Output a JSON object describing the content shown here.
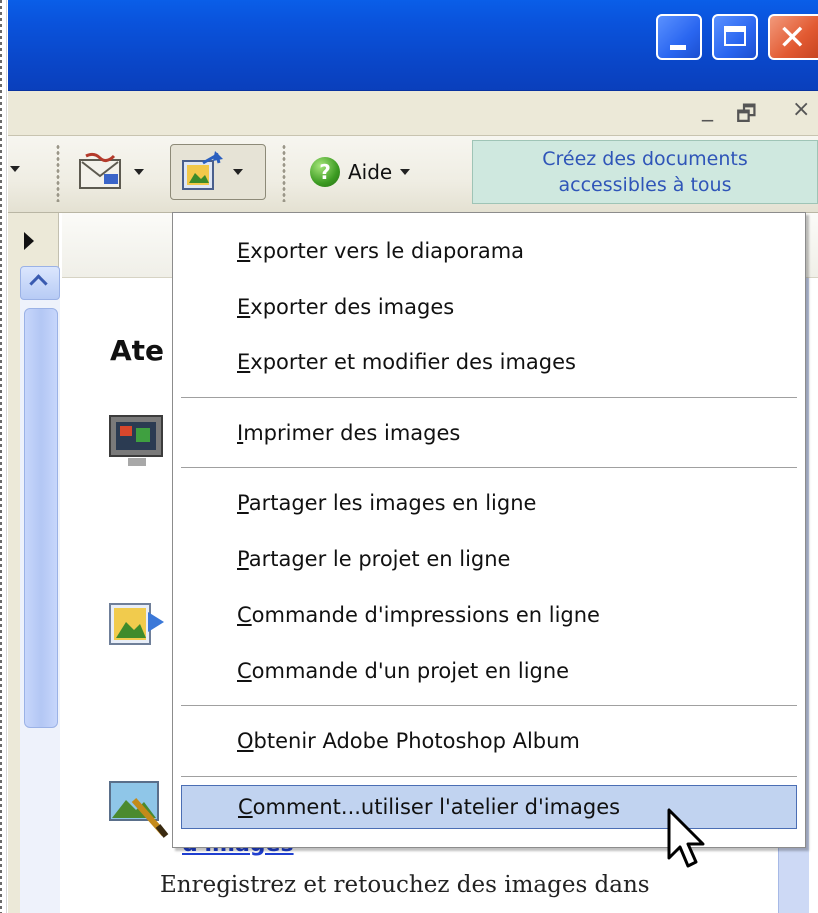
{
  "toolbar": {
    "help_label": "Aide",
    "promo_line1": "Créez des documents",
    "promo_line2": "accessibles à tous"
  },
  "content": {
    "title_fragment": "Ate",
    "link_fragment": "d'images",
    "description": "Enregistrez et retouchez des images dans"
  },
  "menu": {
    "items": [
      {
        "accel": "E",
        "rest": "xporter vers le diaporama"
      },
      {
        "accel": "E",
        "rest": "xporter des images"
      },
      {
        "accel": "E",
        "rest": "xporter et modifier des images"
      },
      {
        "accel": "I",
        "rest": "mprimer des images"
      },
      {
        "accel": "P",
        "rest": "artager les images en ligne"
      },
      {
        "accel": "P",
        "rest": "artager le projet en ligne"
      },
      {
        "accel": "C",
        "rest": "ommande d'impressions en ligne"
      },
      {
        "accel": "C",
        "rest": "ommande d'un projet en ligne"
      },
      {
        "accel": "O",
        "rest": "btenir Adobe Photoshop Album"
      },
      {
        "accel": "C",
        "rest": "omment...utiliser l'atelier d'images"
      }
    ],
    "highlighted_index": 9
  },
  "colors": {
    "title_bar": "#0a53dc",
    "menu_highlight": "#c1d3f0",
    "promo_bg": "#cfe8df",
    "link": "#1f3fd0"
  }
}
